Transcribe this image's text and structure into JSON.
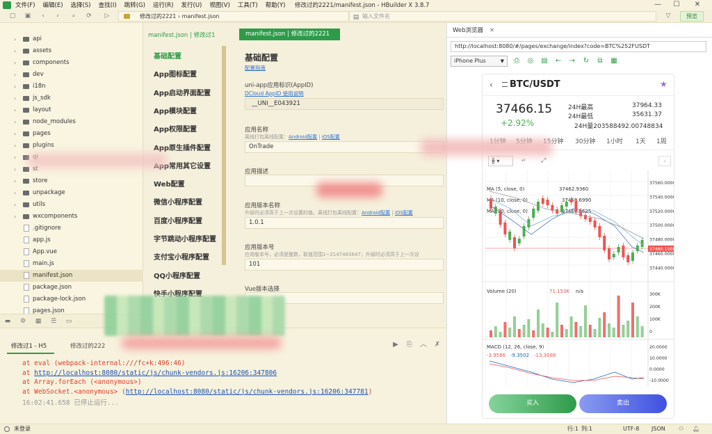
{
  "menubar": {
    "items": [
      "文件(F)",
      "编辑(E)",
      "选择(S)",
      "查找(I)",
      "跳转(G)",
      "运行(R)",
      "发行(U)",
      "视图(V)",
      "工具(T)",
      "帮助(Y)"
    ],
    "window_title": "修改过的2221/manifest.json - HBuilder X 3.8.7"
  },
  "toolbar": {
    "breadcrumb_project": "修改过的2221",
    "breadcrumb_file": "manifest.json",
    "search_placeholder": "输入文件名",
    "preview_label": "预览"
  },
  "sidebar": {
    "items": [
      {
        "name": "api",
        "type": "folder"
      },
      {
        "name": "assets",
        "type": "folder"
      },
      {
        "name": "components",
        "type": "folder"
      },
      {
        "name": "dev",
        "type": "folder"
      },
      {
        "name": "i18n",
        "type": "folder"
      },
      {
        "name": "js_sdk",
        "type": "folder"
      },
      {
        "name": "layout",
        "type": "folder"
      },
      {
        "name": "node_modules",
        "type": "folder"
      },
      {
        "name": "pages",
        "type": "folder"
      },
      {
        "name": "plugins",
        "type": "folder"
      },
      {
        "name": "qi",
        "type": "folder"
      },
      {
        "name": "st",
        "type": "folder"
      },
      {
        "name": "store",
        "type": "folder"
      },
      {
        "name": "unpackage",
        "type": "folder"
      },
      {
        "name": "utils",
        "type": "folder"
      },
      {
        "name": "wxcomponents",
        "type": "folder"
      },
      {
        "name": ".gitignore",
        "type": "file"
      },
      {
        "name": "app.js",
        "type": "file"
      },
      {
        "name": "App.vue",
        "type": "file"
      },
      {
        "name": "main.js",
        "type": "file"
      },
      {
        "name": "manifest.json",
        "type": "file",
        "selected": true
      },
      {
        "name": "package.json",
        "type": "file"
      },
      {
        "name": "package-lock.json",
        "type": "file"
      },
      {
        "name": "pages.json",
        "type": "file"
      }
    ]
  },
  "editor": {
    "tab_inactive": "manifest.json | 修改过1",
    "tab_active": "manifest.json | 修改过的2221",
    "nav": [
      "基础配置",
      "App图标配置",
      "App启动界面配置",
      "App模块配置",
      "App权限配置",
      "App原生插件配置",
      "App常用其它设置",
      "Web配置",
      "微信小程序配置",
      "百度小程序配置",
      "字节跳动小程序配置",
      "支付宝小程序配置",
      "QQ小程序配置",
      "快手小程序配置"
    ],
    "section_title": "基础配置",
    "guide_link": "配置指南",
    "appid_label": "uni-app应用标识(AppID)",
    "appid_link": "DCloud AppID 使用说明",
    "appid_value": "__UNI__E043921",
    "name_label": "应用名称",
    "name_hint": "离线打包离线配置：",
    "hint_android": "Android配置",
    "hint_ios": "iOS配置",
    "name_value": "OnTrade",
    "desc_label": "应用描述",
    "version_name_label": "应用版本名称",
    "version_name_hint": "升级时必须高于上一次设置的值。离线打包离线配置：",
    "version_name_value": "1.0.1",
    "version_code_label": "应用版本号",
    "version_code_hint": "应用版本号，必须是整数，取值范围1~2147483647；升级时必须高于上一次设",
    "version_code_value": "101",
    "vue_label": "Vue版本选择"
  },
  "browser": {
    "tab_label": "Web浏览器",
    "url": "http://localhost:8080/#/pages/exchange/index?code=BTC%252FUSDT",
    "device": "iPhone Plus",
    "page": {
      "pair": "BTC/USDT",
      "price": "37466.15",
      "change": "+2.92%",
      "high_label": "24H最高",
      "high_value": "37964.33",
      "low_label": "24H最低",
      "low_value": "35631.37",
      "vol_label": "24H量",
      "vol_value": "203588492.00748834",
      "intervals": [
        "1分钟",
        "5分钟",
        "15分钟",
        "30分钟",
        "1小时",
        "1天",
        "1周"
      ],
      "ma5": "MA (5, close, 0)",
      "ma5_val": "37462.9360",
      "ma10": "MA (10, close, 0)",
      "ma10_val": "37458.6990",
      "ma30": "MA (30, close, 0)",
      "ma30_val": "37466.5625",
      "price_ticks": [
        "37560.0000",
        "37540.0000",
        "37520.0000",
        "37500.0000",
        "37480.0000",
        "37460.0000",
        "37440.0000"
      ],
      "last_price_tag": "37480.1500",
      "volume_label": "Volume (20)",
      "volume_val": "71.153K",
      "volume_na": "n/a",
      "volume_ticks": [
        "300K",
        "200K",
        "100K",
        "0"
      ],
      "macd_label": "MACD (12, 26, close, 9)",
      "macd_vals": [
        "-3.9586",
        "-9.3502",
        "-13.3088"
      ],
      "macd_ticks": [
        "20.0000",
        "10.0000",
        "0.0000",
        "-10.0000"
      ],
      "buy_label": "买入",
      "sell_label": "卖出"
    }
  },
  "console": {
    "tab_active": "修改过1 - H5",
    "tab_inactive": "修改过的222",
    "lines": [
      {
        "pre": "at eval (webpack-internal:///fc+k:496:46)",
        "url": "",
        "post": ""
      },
      {
        "pre": "at ",
        "url": "http://localhost:8080/static/js/chunk-vendors.js:16206:347806",
        "post": ""
      },
      {
        "pre": "at Array.forEach (<anonymous>)",
        "url": "",
        "post": ""
      },
      {
        "pre": "at WebSocket.<anonymous> (",
        "url": "http://localhost:8080/static/js/chunk-vendors.js:16206:347781",
        "post": ")"
      }
    ],
    "stop_line": "16:02:41.658 已停止运行..."
  },
  "status": {
    "login": "未登录",
    "line": "行:1",
    "col": "列:1",
    "encoding": "UTF-8",
    "lang": "JSON"
  },
  "colors": {
    "accent": "#2e9b4a",
    "bg": "#f5f0dc",
    "up": "#4caf50",
    "down": "#ef5350",
    "buy_grad_end": "#2e9b4a",
    "sell_grad_end": "#3f51e0"
  }
}
